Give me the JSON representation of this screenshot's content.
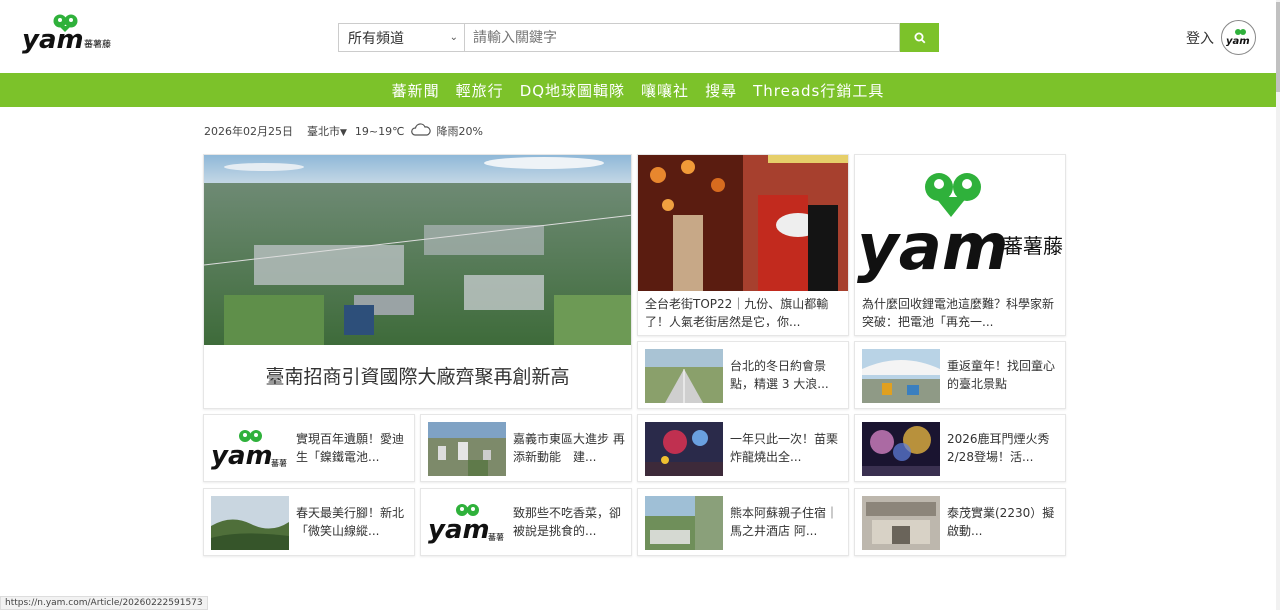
{
  "header": {
    "logo_text": "yam",
    "logo_sub": "蕃薯藤",
    "search": {
      "channel_selected": "所有頻道",
      "placeholder": "請輸入關鍵字"
    },
    "login_label": "登入"
  },
  "nav": {
    "items": [
      "蕃新聞",
      "輕旅行",
      "DQ地球圖輯隊",
      "嚷嚷社",
      "搜尋",
      "Threads行銷工具"
    ]
  },
  "infobar": {
    "date": "2026年02月25日",
    "city": "臺北市",
    "temp": "19~19℃",
    "rain": "降雨20%"
  },
  "hero": {
    "title": "臺南招商引資國際大廠齊聚再創新高"
  },
  "tall_cards": [
    {
      "title": "全台老街TOP22｜九份、旗山都輸了！人氣老街居然是它，你..."
    },
    {
      "title": "為什麼回收鋰電池這麼難？科學家新突破：把電池「再充一..."
    }
  ],
  "small_cards": [
    {
      "title": "台北的冬日約會景點，精選 3 大浪..."
    },
    {
      "title": "重返童年！找回童心的臺北景點"
    },
    {
      "title": "實現百年遺願！愛迪生「鎳鐵電池..."
    },
    {
      "title": "嘉義市東區大進步 再添新動能　建..."
    },
    {
      "title": "一年只此一次！苗栗炸龍燒出全..."
    },
    {
      "title": "2026鹿耳門煙火秀2/28登場！活..."
    },
    {
      "title": "春天最美行腳！新北「微笑山線縱..."
    },
    {
      "title": "致那些不吃香菜，卻被說是挑食的..."
    },
    {
      "title": "熊本阿蘇親子住宿｜馬之井酒店 阿..."
    },
    {
      "title": "泰茂實業(2230）擬啟動..."
    }
  ],
  "status_url": "https://n.yam.com/Article/20260222591573",
  "colors": {
    "brand_green": "#7cc22a",
    "logo_green": "#2fb13b"
  }
}
